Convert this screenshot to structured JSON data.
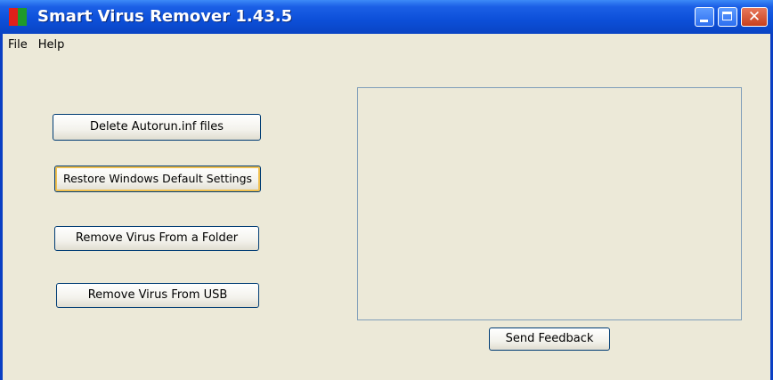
{
  "window": {
    "title": "Smart Virus Remover 1.43.5",
    "controls": {
      "minimize": "minimize-icon",
      "maximize": "maximize-icon",
      "close_glyph": "✕"
    }
  },
  "menu": {
    "items": [
      {
        "label": "File"
      },
      {
        "label": "Help"
      }
    ]
  },
  "actions": {
    "delete_autorun": "Delete Autorun.inf files",
    "restore_defaults": "Restore Windows Default Settings",
    "remove_folder": "Remove Virus From a Folder",
    "remove_usb": "Remove Virus From USB",
    "send_feedback": "Send Feedback"
  },
  "log": {
    "value": ""
  },
  "colors": {
    "titlebar": "#0c4fd8",
    "window_bg": "#ece9d8",
    "button_border": "#003c74",
    "focus_ring": "#f0c050"
  }
}
